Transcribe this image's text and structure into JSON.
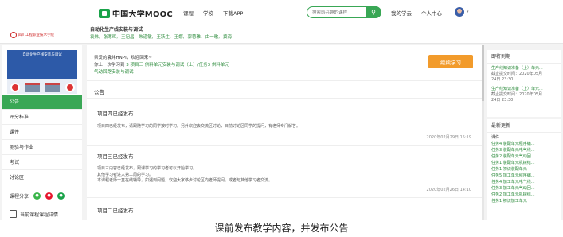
{
  "nav": {
    "logo_text": "中国大学MOOC",
    "links": [
      "课程",
      "学校",
      "下载APP"
    ],
    "search_placeholder": "搜索感兴趣的课程",
    "search_icon": "search-icon",
    "right_links": [
      "我的学云",
      "个人中心"
    ]
  },
  "course": {
    "school_name": "四川工程职业技术学院",
    "title": "自动化生产线安装与调试",
    "teachers": [
      "袁炜,",
      "张寒晖,",
      "王记昌,",
      "朱道敏,",
      "王跃生,",
      "王娜,",
      "郭蓉雅,",
      "由一歌,",
      "冀海"
    ]
  },
  "sidebar": {
    "cover_title": "自动化生产线安装与调试",
    "menu": [
      {
        "label": "公告",
        "active": true
      },
      {
        "label": "评分标准",
        "active": false
      },
      {
        "label": "课件",
        "active": false
      },
      {
        "label": "测验与作业",
        "active": false
      },
      {
        "label": "考试",
        "active": false
      },
      {
        "label": "讨论区",
        "active": false
      }
    ],
    "share_label": "课程分享",
    "cut_label": "当前课程课程详情"
  },
  "main": {
    "greeting": "亲爱的袁炜HNPI，欢迎回来~",
    "last_study_prefix": "你上一次学习到",
    "last_study_link": "3 项目三 供料单元安装与调试（上）/任务3 供料单元",
    "last_study_link2": "气动回路安装与调试",
    "continue_label": "继续学习",
    "section_label": "公告",
    "notices": [
      {
        "title": "项目四已经发布",
        "body": [
          "项目四已经发布，请跟随学习的同学按时学习。另外欢迎去交流区讨论，目前讨论区同学的提问，有老师专门解答。"
        ],
        "date": "2020年02月29日 15:19"
      },
      {
        "title": "项目三已经发布",
        "body": [
          "项目三内容已经发布，跟课学习的学习者可以开始学习。",
          "其他学习者进入第二周的学习。",
          "本课程老师一直在线辅导，如遇到问题，欢迎大家移步讨论区向老师提问，或者与其他学习者交流。"
        ],
        "date": "2020年02月26日 14:10"
      },
      {
        "title": "项目二已经发布",
        "body": [],
        "date": ""
      }
    ]
  },
  "right": {
    "due_header": "即将到期",
    "due_items": [
      {
        "link": "生产线知识准备（上）单元...",
        "meta1": "截止提交时间：2020年05月",
        "meta2": "24日 23:30"
      },
      {
        "link": "生产线知识准备（上）单元...",
        "meta1": "截止提交时间：2020年05月",
        "meta2": "24日 23:30"
      }
    ],
    "updates_header": "最新更新",
    "updates_sub": "课件",
    "update_items": [
      "任务4 装配单元程序编...",
      "任务3 装配单元电气线...",
      "任务2 装配单元气动回...",
      "任务1 装配单元机械结...",
      "任务1 初识装配单元",
      "任务5 加工单元程序编...",
      "任务4 加工单元电气线...",
      "任务3 加工单元气动回...",
      "任务2 加工单元机械结...",
      "任务1 初识加工单元"
    ]
  },
  "caption": "课前发布教学内容，并发布公告",
  "colors": {
    "brand_green": "#39a755",
    "link_green": "#2a8a3a",
    "orange": "#f29b2b",
    "cover_blue": "#2d5aa8"
  }
}
